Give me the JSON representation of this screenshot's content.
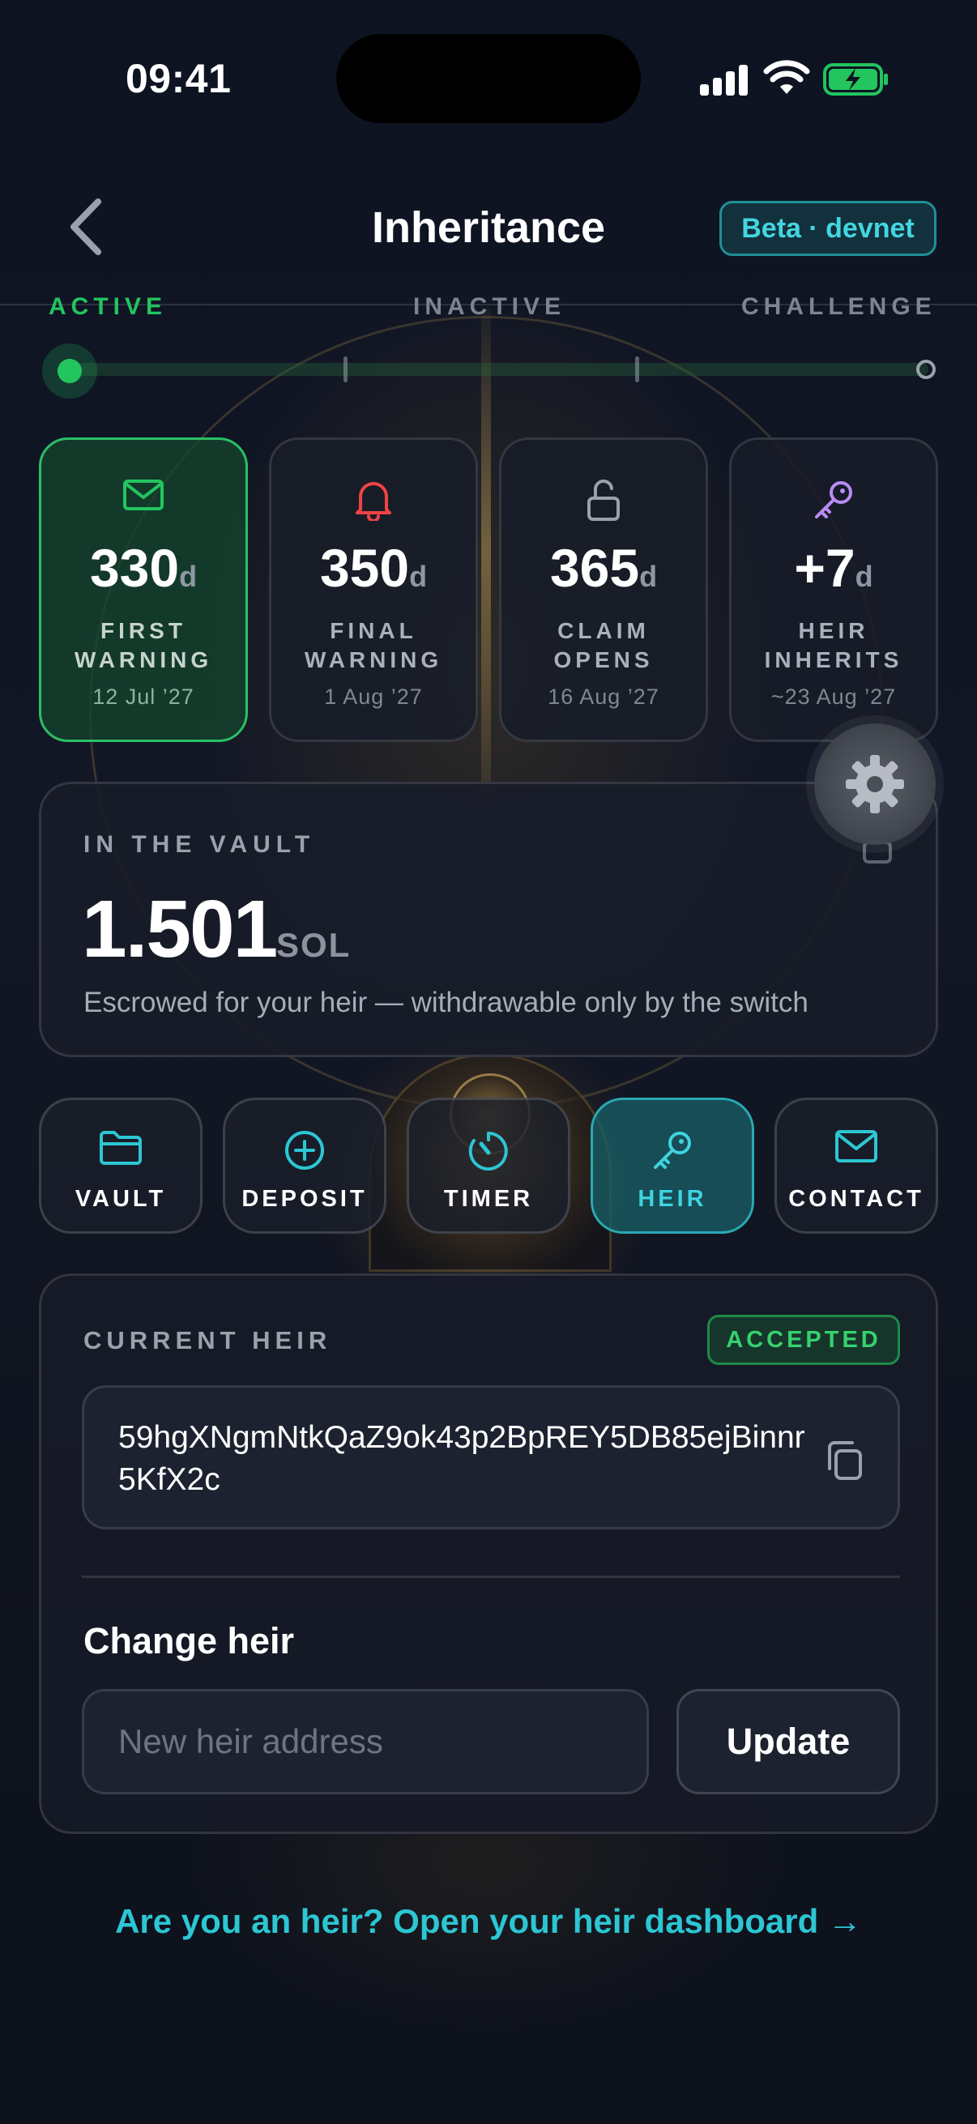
{
  "status_bar": {
    "time": "09:41"
  },
  "header": {
    "title": "Inheritance",
    "badge": "Beta · devnet"
  },
  "timeline": {
    "phases": [
      "ACTIVE",
      "INACTIVE",
      "CHALLENGE"
    ],
    "active_color": "#22c55e"
  },
  "milestones": [
    {
      "icon": "envelope-icon",
      "value": "330",
      "unit": "d",
      "label": "FIRST\nWARNING",
      "date": "12 Jul ’27",
      "active": true
    },
    {
      "icon": "bell-icon",
      "value": "350",
      "unit": "d",
      "label": "FINAL\nWARNING",
      "date": "1 Aug ’27",
      "active": false
    },
    {
      "icon": "unlock-icon",
      "value": "365",
      "unit": "d",
      "label": "CLAIM\nOPENS",
      "date": "16 Aug ’27",
      "active": false
    },
    {
      "icon": "key-icon",
      "value": "+7",
      "unit": "d",
      "label": "HEIR\nINHERITS",
      "date": "~23 Aug ’27",
      "active": false
    }
  ],
  "vault": {
    "label": "IN THE VAULT",
    "amount": "1.501",
    "unit": "SOL",
    "caption": "Escrowed for your heir — withdrawable only by the switch"
  },
  "actions": [
    {
      "icon": "folder-icon",
      "label": "VAULT",
      "selected": false
    },
    {
      "icon": "plus-circle-icon",
      "label": "DEPOSIT",
      "selected": false
    },
    {
      "icon": "timer-icon",
      "label": "TIMER",
      "selected": false
    },
    {
      "icon": "key-icon",
      "label": "HEIR",
      "selected": true
    },
    {
      "icon": "envelope-icon",
      "label": "CONTACT",
      "selected": false
    }
  ],
  "heir": {
    "label": "CURRENT HEIR",
    "status": "ACCEPTED",
    "address": "59hgXNgmNtkQaZ9ok43p2BpREY5DB85ejBinnr5KfX2c",
    "change_heading": "Change heir",
    "input_placeholder": "New heir address",
    "input_value": "",
    "update_label": "Update"
  },
  "footer": {
    "link_text": "Are you an heir? Open your heir dashboard →"
  },
  "colors": {
    "accent_teal": "#2dc6d3",
    "accent_green": "#22c55e",
    "warning_red": "#ef4444",
    "heir_purple": "#b98cf5",
    "background": "#0d1220"
  }
}
